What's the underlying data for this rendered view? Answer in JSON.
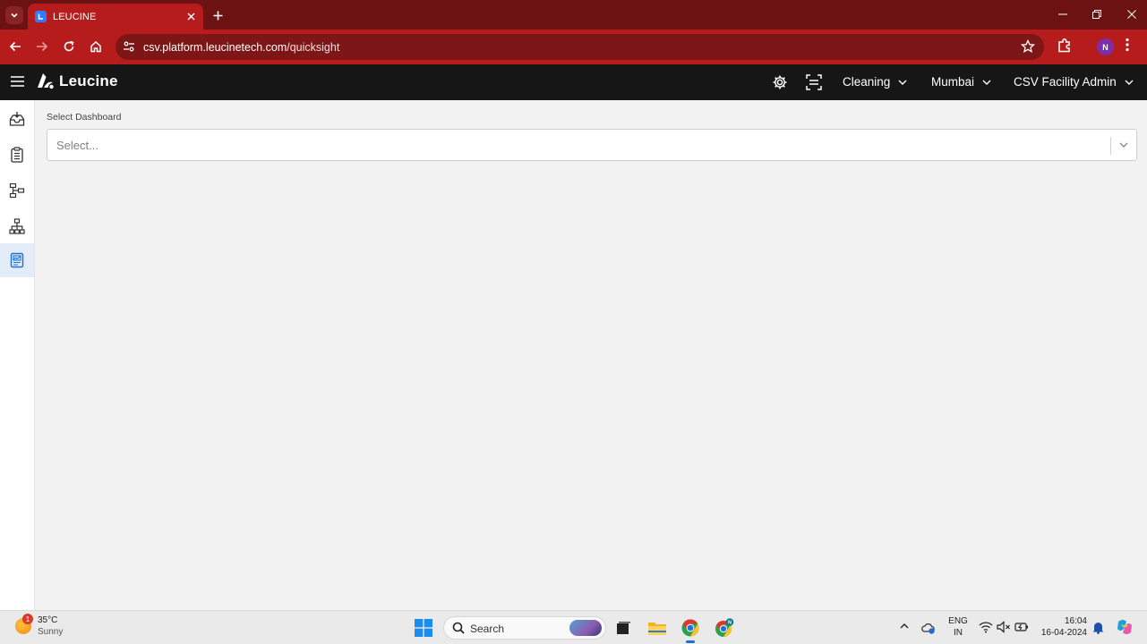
{
  "browser": {
    "tab_title": "LEUCINE",
    "url_host": "csv.platform.leucinetech.com",
    "url_path": "/quicksight",
    "profile_initial": "N"
  },
  "header": {
    "logo_text": "Leucine",
    "use_case": "Cleaning",
    "facility": "Mumbai",
    "role": "CSV Facility Admin"
  },
  "sidebar": {
    "items": [
      {
        "icon": "inbox-icon",
        "active": false
      },
      {
        "icon": "checklist-icon",
        "active": false
      },
      {
        "icon": "process-icon",
        "active": false
      },
      {
        "icon": "ontology-icon",
        "active": false
      },
      {
        "icon": "dashboard-icon",
        "active": true
      }
    ]
  },
  "main": {
    "label": "Select Dashboard",
    "placeholder": "Select..."
  },
  "taskbar": {
    "weather_temp": "35°C",
    "weather_desc": "Sunny",
    "weather_badge": "1",
    "search_label": "Search",
    "lang_top": "ENG",
    "lang_bottom": "IN",
    "time": "16:04",
    "date": "16-04-2024"
  },
  "colors": {
    "tab_bar": "#6d1212",
    "toolbar": "#b71c1c",
    "app_header": "#161616",
    "sidebar_active": "#e3edfa"
  }
}
